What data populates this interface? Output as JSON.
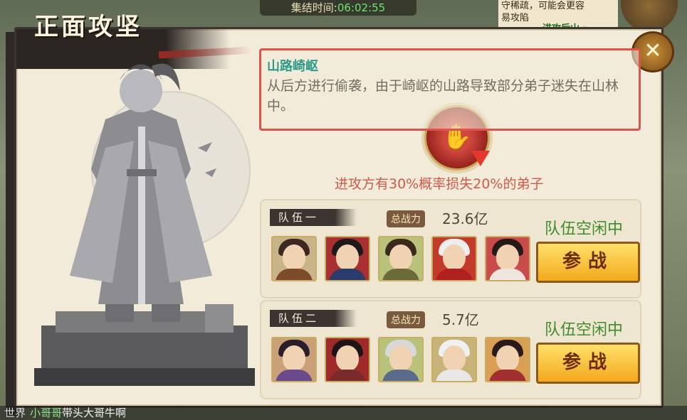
{
  "topbar": {
    "label": "集结时间:",
    "time": "06:02:55"
  },
  "tip": {
    "line1": "守稀疏，可能会更容",
    "line2": "易攻陷",
    "attack_link": "进攻后山 »"
  },
  "panel": {
    "title": "正面攻坚",
    "route_title": "山路崎岖",
    "route_desc": "从后方进行偷袭，由于崎岖的山路导致部分弟子迷失在山林中。",
    "effect": "进攻方有30%概率损失20%的弟子"
  },
  "teams": [
    {
      "label": "队伍一",
      "power_label": "总战力",
      "power": "23.6亿",
      "status": "队伍空闲中",
      "join_label": "参战",
      "members": [
        {
          "bg": "#c9b48a",
          "robe": "#7d4a2a",
          "hair": "#3b2820"
        },
        {
          "bg": "#a93030",
          "robe": "#2a3c6b",
          "hair": "#1e1a1a"
        },
        {
          "bg": "#b8c27a",
          "robe": "#6b6a3a",
          "hair": "#3a2a1e"
        },
        {
          "bg": "#c23a2a",
          "robe": "#b02020",
          "hair": "#eeeeee"
        },
        {
          "bg": "#c94b4b",
          "robe": "#f0e6e0",
          "hair": "#241a18"
        }
      ]
    },
    {
      "label": "队伍二",
      "power_label": "总战力",
      "power": "5.7亿",
      "status": "队伍空闲中",
      "join_label": "参战",
      "members": [
        {
          "bg": "#c9a078",
          "robe": "#6a4a8a",
          "hair": "#2a1e2a"
        },
        {
          "bg": "#a02a2a",
          "robe": "#7a2a2a",
          "hair": "#1e1616"
        },
        {
          "bg": "#b8c27a",
          "robe": "#5a6a8a",
          "hair": "#d8d8d8"
        },
        {
          "bg": "#c8b47a",
          "robe": "#e8e8e8",
          "hair": "#f0f0f0"
        },
        {
          "bg": "#d9a055",
          "robe": "#a03030",
          "hair": "#2a1a1a"
        }
      ]
    }
  ],
  "chat": {
    "channel": "世界",
    "user": "小哥哥",
    "message": "带头大哥牛啊"
  }
}
